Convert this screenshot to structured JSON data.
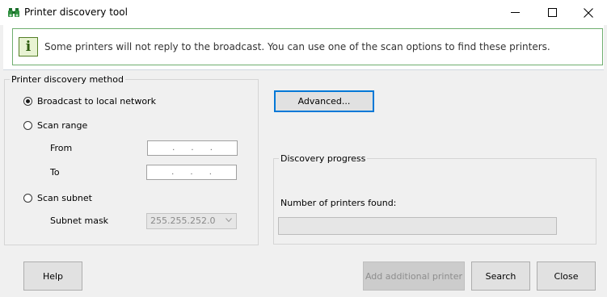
{
  "window": {
    "title": "Printer discovery tool",
    "minimize_symbol": "—",
    "close_symbol": "✕"
  },
  "info": {
    "icon_glyph": "i",
    "message": "Some printers will not reply to the broadcast. You can use one of the scan options to find these printers."
  },
  "method": {
    "title": "Printer discovery method",
    "broadcast_label": "Broadcast to local network",
    "scan_range_label": "Scan range",
    "from_label": "From",
    "to_label": "To",
    "scan_subnet_label": "Scan subnet",
    "subnet_mask_label": "Subnet mask",
    "subnet_mask_value": "255.255.252.0",
    "selected": "broadcast"
  },
  "advanced_label": "Advanced...",
  "progress": {
    "title": "Discovery progress",
    "printers_found_label": "Number of printers found:",
    "value": 0
  },
  "buttons": {
    "help": "Help",
    "add_printer": "Add additional printer",
    "search": "Search",
    "close": "Close"
  },
  "colors": {
    "focus_blue": "#0078d7",
    "info_green_border": "#6fae6f",
    "progress_green": "#06b025"
  }
}
